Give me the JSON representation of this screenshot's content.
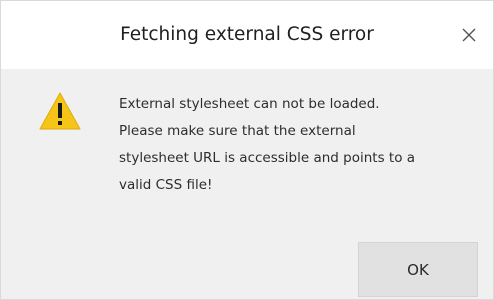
{
  "dialog": {
    "title": "Fetching external CSS error",
    "close_icon": "close-icon",
    "warning_icon": "warning-triangle-icon",
    "message_lines": [
      "External stylesheet can not be loaded.",
      "Please make sure that the external",
      "stylesheet URL is accessible and points to a",
      "valid CSS file!"
    ],
    "ok_label": "OK",
    "colors": {
      "warning": "#f5c518",
      "titlebar": "#ffffff",
      "body": "#f0f0f0",
      "button": "#e1e1e1"
    }
  }
}
